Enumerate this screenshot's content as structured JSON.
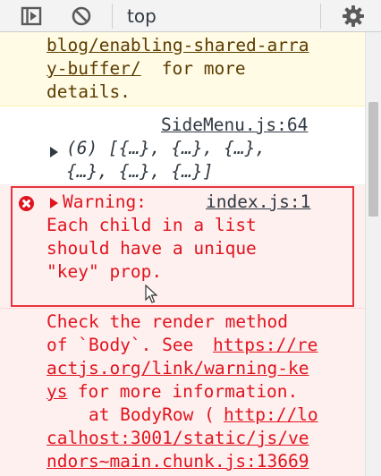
{
  "toolbar": {
    "context_label": "top",
    "sidebar_toggle": "show-console-sidebar",
    "clear": "clear-console",
    "settings": "console-settings"
  },
  "messages": {
    "deprecation": {
      "line1": "blog/enabling-shared-arra",
      "line2_link": "y-buffer/",
      "line2_rest": " for more",
      "line3": "details."
    },
    "log": {
      "source": "SideMenu.js:64",
      "line1": "(6) [{…}, {…}, {…},",
      "line2": "{…}, {…}, {…}]"
    },
    "error": {
      "label": "Warning:",
      "source": "index.js:1",
      "line1": "Each child in a list",
      "line2": "should have a unique",
      "line3": "\"key\" prop."
    },
    "error_detail": {
      "l1": "Check the render method",
      "l2_pre": "of `Body`. See ",
      "l2_link": "https://re",
      "l3_link": "actjs.org/link/warning-ke",
      "l4_link": "ys",
      "l4_rest": " for more information.",
      "l5_pre": "    at BodyRow (",
      "l5_link": "http://lo",
      "l6_link": "calhost:3001/static/js/ve",
      "l7_link": "ndors~main.chunk.js:13669"
    }
  },
  "colors": {
    "error": "#e0141e",
    "warning_bg": "#fffbe5",
    "error_bg": "#fff0f0",
    "highlight": "#e8343b"
  }
}
